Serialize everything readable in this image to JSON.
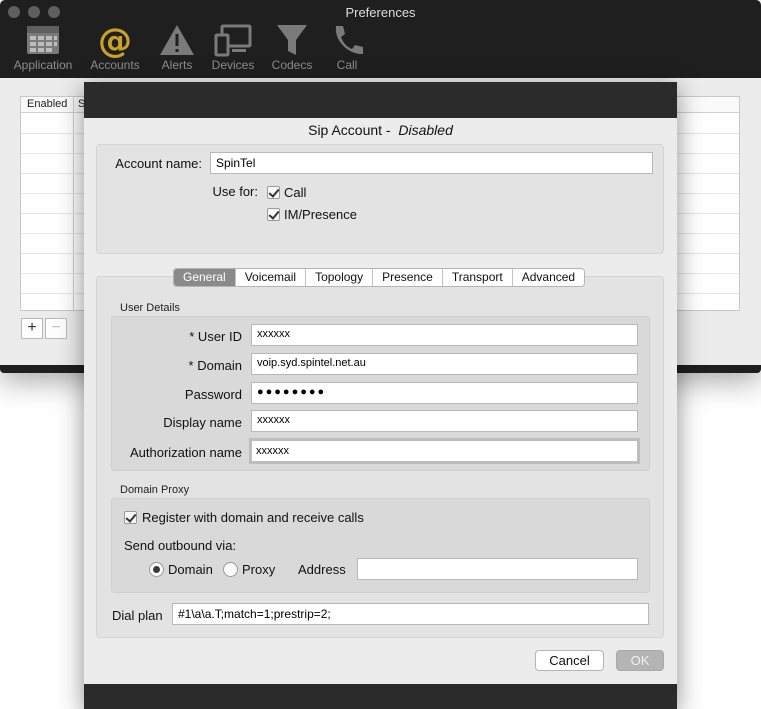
{
  "window": {
    "title": "Preferences"
  },
  "toolbar": {
    "items": [
      {
        "label": "Application"
      },
      {
        "label": "Accounts"
      },
      {
        "label": "Alerts"
      },
      {
        "label": "Devices"
      },
      {
        "label": "Codecs"
      },
      {
        "label": "Call"
      }
    ],
    "active_color": "#c9a227"
  },
  "accounts_table": {
    "columns": [
      "Enabled",
      "S"
    ],
    "add_label": "+",
    "remove_label": "−"
  },
  "sheet": {
    "title": "Sip Account -",
    "status": "Disabled",
    "account_name_label": "Account name:",
    "account_name": "SpinTel",
    "use_for_label": "Use for:",
    "use_call_label": "Call",
    "use_call_checked": true,
    "use_im_label": "IM/Presence",
    "use_im_checked": true,
    "tabs": [
      "General",
      "Voicemail",
      "Topology",
      "Presence",
      "Transport",
      "Advanced"
    ],
    "selected_tab": "General",
    "user_details": {
      "section": "User Details",
      "user_id_label": "* User ID",
      "user_id": "xxxxxx",
      "domain_label": "* Domain",
      "domain": "voip.syd.spintel.net.au",
      "password_label": "Password",
      "password_mask": "●●●●●●●●",
      "display_name_label": "Display name",
      "display_name": "xxxxxx",
      "auth_name_label": "Authorization name",
      "auth_name": "xxxxxx"
    },
    "domain_proxy": {
      "section": "Domain Proxy",
      "register_label": "Register with domain and receive calls",
      "register_checked": true,
      "send_outbound_label": "Send outbound via:",
      "domain_option": "Domain",
      "proxy_option": "Proxy",
      "selected_option": "Domain",
      "address_label": "Address",
      "address": ""
    },
    "dial_plan_label": "Dial plan",
    "dial_plan": "#1\\a\\a.T;match=1;prestrip=2;",
    "cancel_label": "Cancel",
    "ok_label": "OK"
  }
}
